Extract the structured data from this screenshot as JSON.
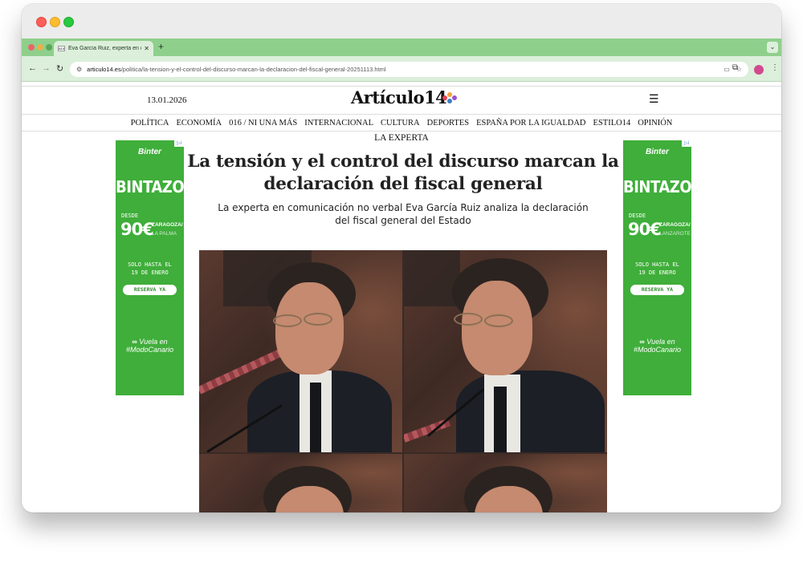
{
  "browser": {
    "tab_title": "Eva García Ruiz, experta en c",
    "tab_favicon": "A14",
    "url_domain": "articulo14.es",
    "url_path": "/politica/la-tension-y-el-control-del-discurso-marcan-la-declaracion-del-fiscal-general-20251113.html",
    "theme_color": "#8fcf8c"
  },
  "site": {
    "date": "13.01.2026",
    "logo_text": "Artículo14",
    "logo_dot_colors": [
      "#e8454f",
      "#f2a33a",
      "#3a7fc4",
      "#9b51c9"
    ],
    "nav_items": [
      "POLÍTICA",
      "ECONOMÍA",
      "016 / NI UNA MÁS",
      "INTERNACIONAL",
      "CULTURA",
      "DEPORTES",
      "ESPAÑA POR LA IGUALDAD",
      "ESTILO14",
      "OPINIÓN"
    ]
  },
  "article": {
    "section": "LA EXPERTA",
    "headline": "La tensión y el control del discurso marcan la declaración del fiscal general",
    "subhead": "La experta en comunicación no verbal Eva García Ruiz analiza la declaración del fiscal general del Estado"
  },
  "ads": {
    "left": {
      "brand": "Binter",
      "promo": "BINTAZO",
      "desde": "DESDE",
      "price": "90€",
      "route_main": "ZARAGOZA/",
      "route_sub": "LA PALMA",
      "until": "SOLO HASTA EL 19 DE ENERO",
      "cta": "RESERVA YA",
      "tagline_1": "Vuela en",
      "tagline_2": "#ModoCanario",
      "color": "#3fae3a"
    },
    "right": {
      "brand": "Binter",
      "promo": "BINTAZO",
      "desde": "DESDE",
      "price": "90€",
      "route_main": "ZARAGOZA/",
      "route_sub": "LANZAROTE",
      "until": "SOLO HASTA EL 19 DE ENERO",
      "cta": "RESERVA YA",
      "tagline_1": "Vuela en",
      "tagline_2": "#ModoCanario",
      "color": "#3fae3a"
    }
  }
}
